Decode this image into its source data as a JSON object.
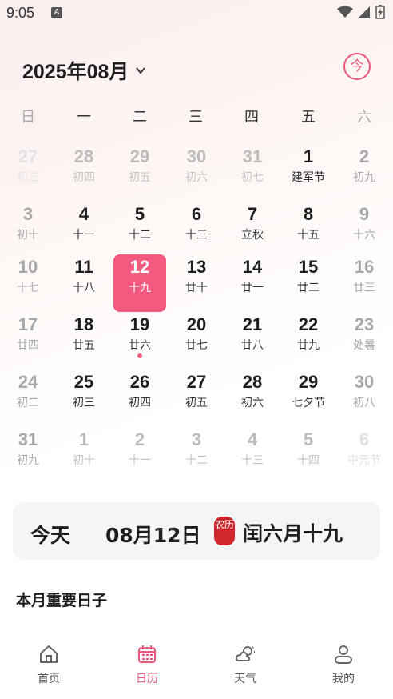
{
  "status_bar": {
    "time": "9:05",
    "notification_badge": "A"
  },
  "header": {
    "month_title": "2025年08月",
    "today_button": "今"
  },
  "weekdays": [
    "日",
    "一",
    "二",
    "三",
    "四",
    "五",
    "六"
  ],
  "calendar": {
    "rows": [
      [
        {
          "day": "27",
          "lunar": "初三",
          "style": "faint2"
        },
        {
          "day": "28",
          "lunar": "初四",
          "style": "faint"
        },
        {
          "day": "29",
          "lunar": "初五",
          "style": "faint"
        },
        {
          "day": "30",
          "lunar": "初六",
          "style": "faint"
        },
        {
          "day": "31",
          "lunar": "初七",
          "style": "faint"
        },
        {
          "day": "1",
          "lunar": "建军节",
          "style": "cur"
        },
        {
          "day": "2",
          "lunar": "初九",
          "style": "wknd"
        }
      ],
      [
        {
          "day": "3",
          "lunar": "初十",
          "style": "wknd"
        },
        {
          "day": "4",
          "lunar": "十一",
          "style": "cur"
        },
        {
          "day": "5",
          "lunar": "十二",
          "style": "cur"
        },
        {
          "day": "6",
          "lunar": "十三",
          "style": "cur"
        },
        {
          "day": "7",
          "lunar": "立秋",
          "style": "cur"
        },
        {
          "day": "8",
          "lunar": "十五",
          "style": "cur"
        },
        {
          "day": "9",
          "lunar": "十六",
          "style": "wknd"
        }
      ],
      [
        {
          "day": "10",
          "lunar": "十七",
          "style": "wknd"
        },
        {
          "day": "11",
          "lunar": "十八",
          "style": "cur"
        },
        {
          "day": "12",
          "lunar": "十九",
          "style": "sel"
        },
        {
          "day": "13",
          "lunar": "廿十",
          "style": "cur"
        },
        {
          "day": "14",
          "lunar": "廿一",
          "style": "cur"
        },
        {
          "day": "15",
          "lunar": "廿二",
          "style": "cur"
        },
        {
          "day": "16",
          "lunar": "廿三",
          "style": "wknd"
        }
      ],
      [
        {
          "day": "17",
          "lunar": "廿四",
          "style": "wknd"
        },
        {
          "day": "18",
          "lunar": "廿五",
          "style": "cur"
        },
        {
          "day": "19",
          "lunar": "廿六",
          "style": "cur",
          "dot": true
        },
        {
          "day": "20",
          "lunar": "廿七",
          "style": "cur"
        },
        {
          "day": "21",
          "lunar": "廿八",
          "style": "cur"
        },
        {
          "day": "22",
          "lunar": "廿九",
          "style": "cur"
        },
        {
          "day": "23",
          "lunar": "处暑",
          "style": "wknd"
        }
      ],
      [
        {
          "day": "24",
          "lunar": "初二",
          "style": "wknd"
        },
        {
          "day": "25",
          "lunar": "初三",
          "style": "cur"
        },
        {
          "day": "26",
          "lunar": "初四",
          "style": "cur"
        },
        {
          "day": "27",
          "lunar": "初五",
          "style": "cur"
        },
        {
          "day": "28",
          "lunar": "初六",
          "style": "cur"
        },
        {
          "day": "29",
          "lunar": "七夕节",
          "style": "cur"
        },
        {
          "day": "30",
          "lunar": "初八",
          "style": "wknd"
        }
      ],
      [
        {
          "day": "31",
          "lunar": "初九",
          "style": "wknd"
        },
        {
          "day": "1",
          "lunar": "初十",
          "style": "faint"
        },
        {
          "day": "2",
          "lunar": "十一",
          "style": "faint"
        },
        {
          "day": "3",
          "lunar": "十二",
          "style": "faint"
        },
        {
          "day": "4",
          "lunar": "十三",
          "style": "faint"
        },
        {
          "day": "5",
          "lunar": "十四",
          "style": "faint"
        },
        {
          "day": "6",
          "lunar": "中元节",
          "style": "faint2"
        }
      ]
    ]
  },
  "today_card": {
    "label": "今天",
    "date": "08月12日",
    "seal_text": "农历",
    "lunar_date": "闰六月十九"
  },
  "section": {
    "title": "本月重要日子"
  },
  "tabs": [
    {
      "label": "首页",
      "icon": "home-icon",
      "active": false
    },
    {
      "label": "日历",
      "icon": "calendar-icon",
      "active": true
    },
    {
      "label": "天气",
      "icon": "weather-icon",
      "active": false
    },
    {
      "label": "我的",
      "icon": "profile-icon",
      "active": false
    }
  ],
  "colors": {
    "accent": "#f35a7f",
    "seal": "#d0272e"
  }
}
